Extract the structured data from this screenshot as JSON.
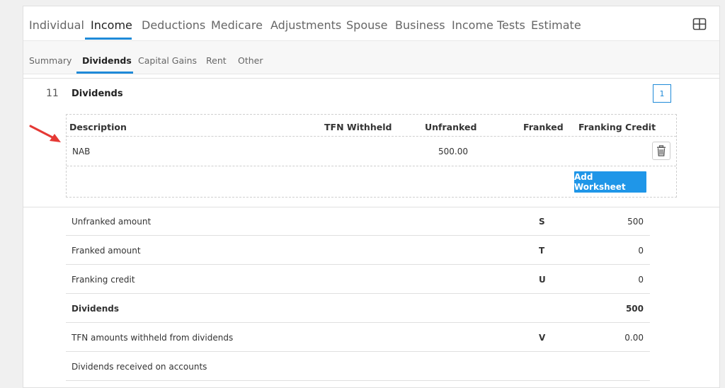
{
  "main_tabs": [
    "Individual",
    "Income",
    "Deductions",
    "Medicare",
    "Adjustments",
    "Spouse",
    "Business",
    "Income Tests",
    "Estimate"
  ],
  "main_tab_active": "Income",
  "sub_tabs": [
    "Summary",
    "Dividends",
    "Capital Gains",
    "Rent",
    "Other"
  ],
  "sub_tab_active": "Dividends",
  "section": {
    "number": "11",
    "title": "Dividends",
    "count": "1"
  },
  "worksheet": {
    "columns": [
      "Description",
      "TFN Withheld",
      "Unfranked",
      "Franked",
      "Franking Credit"
    ],
    "rows": [
      {
        "description": "NAB",
        "tfn_withheld": "",
        "unfranked": "500.00",
        "franked": "",
        "franking_credit": ""
      }
    ],
    "add_button": "Add Worksheet"
  },
  "summary_rows": [
    {
      "label": "Unfranked amount",
      "code": "S",
      "value": "500"
    },
    {
      "label": "Franked amount",
      "code": "T",
      "value": "0"
    },
    {
      "label": "Franking credit",
      "code": "U",
      "value": "0"
    },
    {
      "label": "Dividends",
      "code": "",
      "value": "500"
    },
    {
      "label": "TFN amounts withheld from dividends",
      "code": "V",
      "value": "0.00"
    },
    {
      "label": "Dividends received on accounts",
      "code": "",
      "value": ""
    }
  ],
  "colors": {
    "accent": "#1f8ad8",
    "button": "#1f96e8",
    "arrow": "#e53935"
  },
  "icons": {
    "layout": "grid-layout-icon",
    "delete": "trash-icon",
    "pointer": "red-arrow-annotation"
  }
}
